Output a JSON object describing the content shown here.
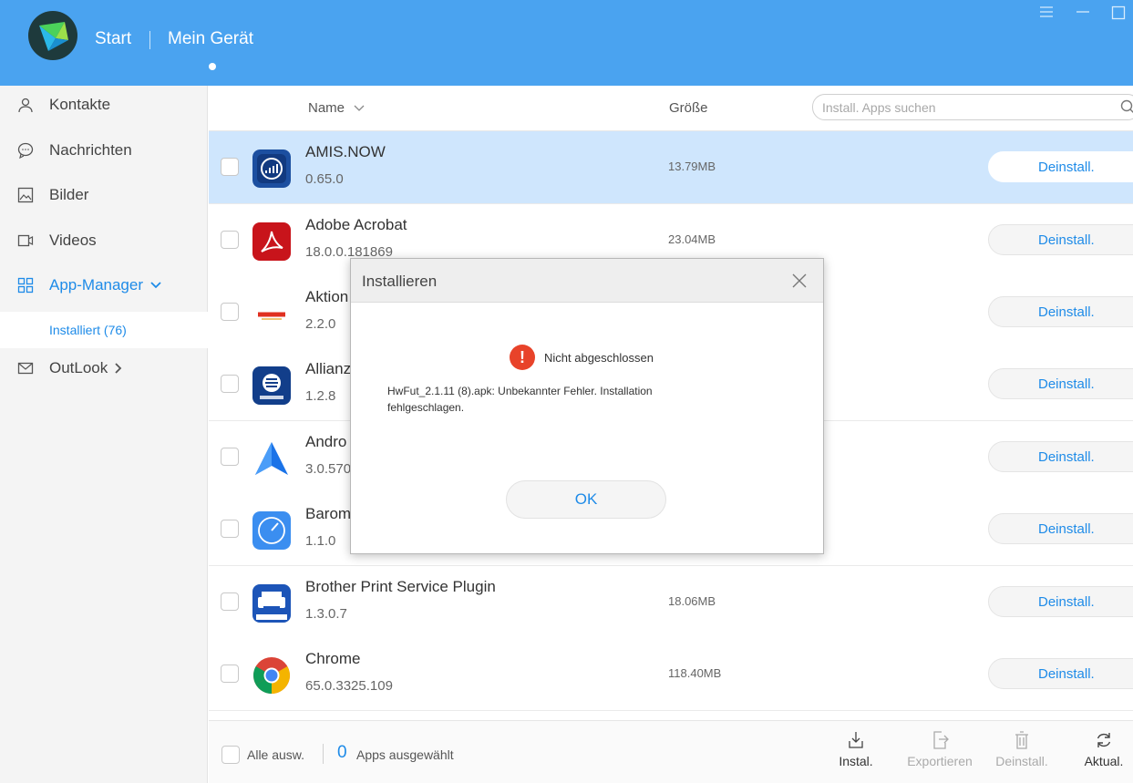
{
  "header": {
    "nav_start": "Start",
    "nav_device": "Mein Gerät",
    "accent": "#4aa3f0"
  },
  "sidebar": {
    "items": [
      {
        "label": "Kontakte",
        "icon": "person-icon"
      },
      {
        "label": "Nachrichten",
        "icon": "chat-bubble-icon"
      },
      {
        "label": "Bilder",
        "icon": "image-icon"
      },
      {
        "label": "Videos",
        "icon": "video-icon"
      },
      {
        "label": "App-Manager",
        "icon": "grid-icon",
        "active": true
      },
      {
        "label": "OutLook",
        "icon": "mail-icon"
      }
    ],
    "sub_item": "Installiert (76)"
  },
  "table": {
    "col_name": "Name",
    "col_size": "Größe",
    "search_placeholder": "Install. Apps suchen",
    "uninstall_label": "Deinstall.",
    "rows": [
      {
        "name": "AMIS.NOW",
        "version": "0.65.0",
        "size": "13.79MB",
        "selected": true
      },
      {
        "name": "Adobe Acrobat",
        "version": "18.0.0.181869",
        "size": "23.04MB"
      },
      {
        "name": "Aktion",
        "version": "2.2.0",
        "size": ""
      },
      {
        "name": "Allianz",
        "version": "1.2.8",
        "size": ""
      },
      {
        "name": "Andro",
        "version": "3.0.570",
        "size": ""
      },
      {
        "name": "Barom",
        "version": "1.1.0",
        "size": ""
      },
      {
        "name": "Brother Print Service Plugin",
        "version": "1.3.0.7",
        "size": "18.06MB"
      },
      {
        "name": "Chrome",
        "version": "65.0.3325.109",
        "size": "118.40MB"
      }
    ]
  },
  "footer": {
    "select_all": "Alle ausw.",
    "count": "0",
    "selected_label": "Apps ausgewählt",
    "actions": {
      "install": "Instal.",
      "export": "Exportieren",
      "uninstall": "Deinstall.",
      "refresh": "Aktual."
    }
  },
  "modal": {
    "title": "Installieren",
    "status": "Nicht abgeschlossen",
    "message": "HwFut_2.1.11 (8).apk: Unbekannter Fehler. Installation fehlgeschlagen.",
    "ok": "OK",
    "error_color": "#e8432a"
  }
}
